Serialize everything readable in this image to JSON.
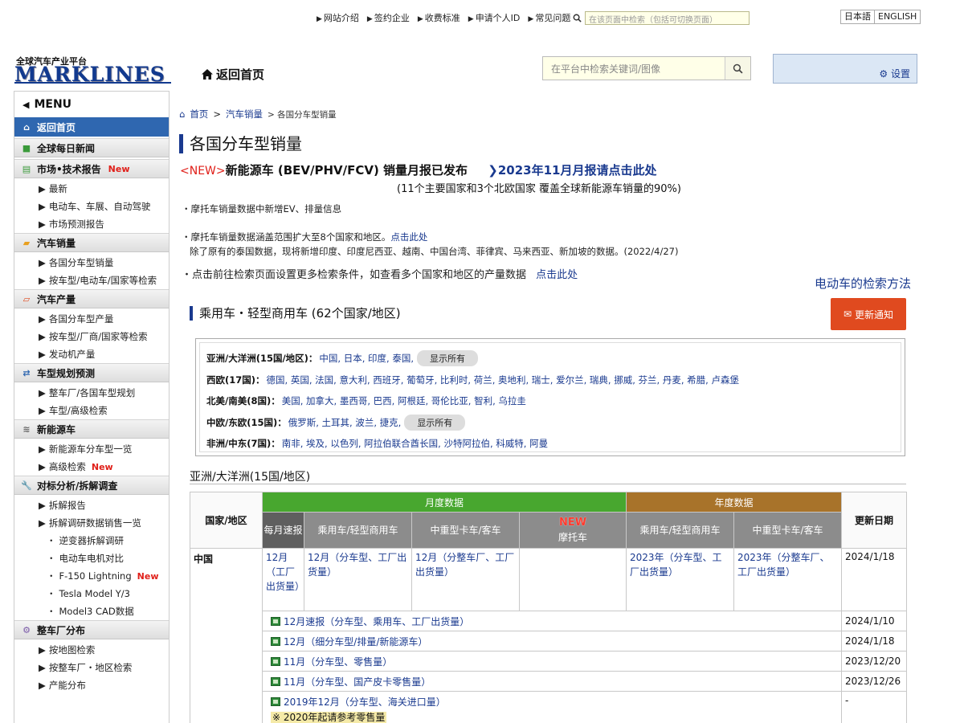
{
  "top_nav": {
    "links": [
      "网站介绍",
      "签约企业",
      "收费标准",
      "申请个人ID",
      "常见问题"
    ],
    "site_search_placeholder": "在该页面中检索（包括可切换页面）",
    "lang_ja": "日本語",
    "lang_en": "ENGLISH"
  },
  "header": {
    "logo_sub": "全球汽车产业平台",
    "logo": "MARKLINES",
    "home_link": "返回首页",
    "search_placeholder": "在平台中检索关键词/图像",
    "settings": "设置"
  },
  "sidebar": {
    "menu_label": "MENU",
    "home": "返回首页",
    "news": "全球每日新闻",
    "reports": {
      "label": "市场•技术报告",
      "new": "New",
      "items": [
        "最新",
        "电动车、车展、自动驾驶",
        "市场预测报告"
      ]
    },
    "sales": {
      "label": "汽车销量",
      "items": [
        "各国分车型销量",
        "按车型/电动车/国家等检索"
      ]
    },
    "production": {
      "label": "汽车产量",
      "items": [
        "各国分车型产量",
        "按车型/厂商/国家等检索",
        "发动机产量"
      ]
    },
    "planning": {
      "label": "车型规划预测",
      "items": [
        "整车厂/各国车型规划",
        "车型/高级检索"
      ]
    },
    "ev": {
      "label": "新能源车",
      "items": [
        "新能源车分车型一览",
        "高级检索"
      ],
      "new": "New"
    },
    "teardown": {
      "label": "对标分析/拆解调查",
      "items": [
        "拆解报告",
        "拆解调研数据销售一览"
      ],
      "dots": [
        "逆变器拆解调研",
        "电动车电机对比",
        "F-150 Lightning",
        "Tesla Model Y/3",
        "Model3 CAD数据"
      ],
      "new": "New"
    },
    "plants": {
      "label": "整车厂分布",
      "items": [
        "按地图检索",
        "按整车厂・地区检索",
        "产能分布"
      ]
    }
  },
  "breadcrumb": {
    "home": "首页",
    "sales": "汽车销量",
    "current": "各国分车型销量"
  },
  "page_title": "各国分车型销量",
  "banner": {
    "new_tag": "<NEW>",
    "text": "新能源车 (BEV/PHV/FCV) 销量月报已发布",
    "link": "2023年11月月报请点击此处",
    "sub": "(11个主要国家和3个北欧国家 覆盖全球新能源车销量的90%)"
  },
  "notes": {
    "n1": "・摩托车销量数据中新增EV、排量信息",
    "n2": "・摩托车销量数据涵盖范围扩大至8个国家和地区。",
    "n2_link": "点击此处",
    "n3": "除了原有的泰国数据，现将新增印度、印度尼西亚、越南、中国台湾、菲律宾、马来西亚、新加坡的数据。(2022/4/27)",
    "n4": "・点击前往检索页面设置更多检索条件，如查看多个国家和地区的产量数据",
    "n4_link": "点击此处"
  },
  "ev_method": "电动车的检索方法",
  "section_title": "乘用车・轻型商用车 (62个国家/地区)",
  "update_button": "更新通知",
  "regions": [
    {
      "label": "亚洲/大洋洲(15国/地区)：",
      "countries": "中国, 日本, 印度, 泰国,",
      "show_all": "显示所有"
    },
    {
      "label": "西欧(17国)：",
      "countries": "德国, 英国, 法国, 意大利, 西班牙, 葡萄牙, 比利时, 荷兰, 奥地利, 瑞士, 爱尔兰, 瑞典, 挪威, 芬兰, 丹麦, 希腊, 卢森堡",
      "show_all": ""
    },
    {
      "label": "北美/南美(8国)：",
      "countries": "美国, 加拿大, 墨西哥, 巴西, 阿根廷, 哥伦比亚, 智利, 乌拉圭",
      "show_all": ""
    },
    {
      "label": "中欧/东欧(15国)：",
      "countries": "俄罗斯, 土耳其, 波兰, 捷克,",
      "show_all": "显示所有"
    },
    {
      "label": "非洲/中东(7国)：",
      "countries": "南非, 埃及, 以色列, 阿拉伯联合酋长国, 沙特阿拉伯, 科威特, 阿曼",
      "show_all": ""
    }
  ],
  "asia_heading": "亚洲/大洋洲(15国/地区)",
  "table": {
    "col_country": "国家/地区",
    "monthly": "月度数据",
    "annual": "年度数据",
    "updated": "更新日期",
    "sub_flash": "每月速报",
    "sub_pc": "乘用车/轻型商用车",
    "sub_truck": "中重型卡车/客车",
    "sub_moto_new": "NEW",
    "sub_moto": "摩托车",
    "sub_pc_y": "乘用车/轻型商用车",
    "sub_truck_y": "中重型卡车/客车",
    "china": {
      "name": "中国",
      "flash": "12月（工厂出货量）",
      "pc": "12月（分车型、工厂出货量）",
      "truck": "12月（分整车厂、工厂出货量）",
      "pc_y": "2023年（分车型、工厂出货量）",
      "truck_y": "2023年（分整车厂、工厂出货量）",
      "date": "2024/1/18"
    },
    "links": [
      {
        "text": "12月速报（分车型、乘用车、工厂出货量）",
        "date": "2024/1/10"
      },
      {
        "text": "12月（细分车型/排量/新能源车）",
        "date": "2024/1/18"
      },
      {
        "text": "11月（分车型、零售量）",
        "date": "2023/12/20"
      },
      {
        "text": "11月（分车型、国产皮卡零售量）",
        "date": "2023/12/26"
      },
      {
        "text": "2019年12月（分车型、海关进口量）",
        "date": "-",
        "note": "※ 2020年起请参考零售量"
      }
    ]
  },
  "colors": {
    "brand_blue": "#1a3a8f",
    "active_blue": "#2f67b0",
    "green": "#48a72f",
    "brown": "#a8732a",
    "orange": "#e04a1f",
    "new_red": "#e0201a"
  }
}
